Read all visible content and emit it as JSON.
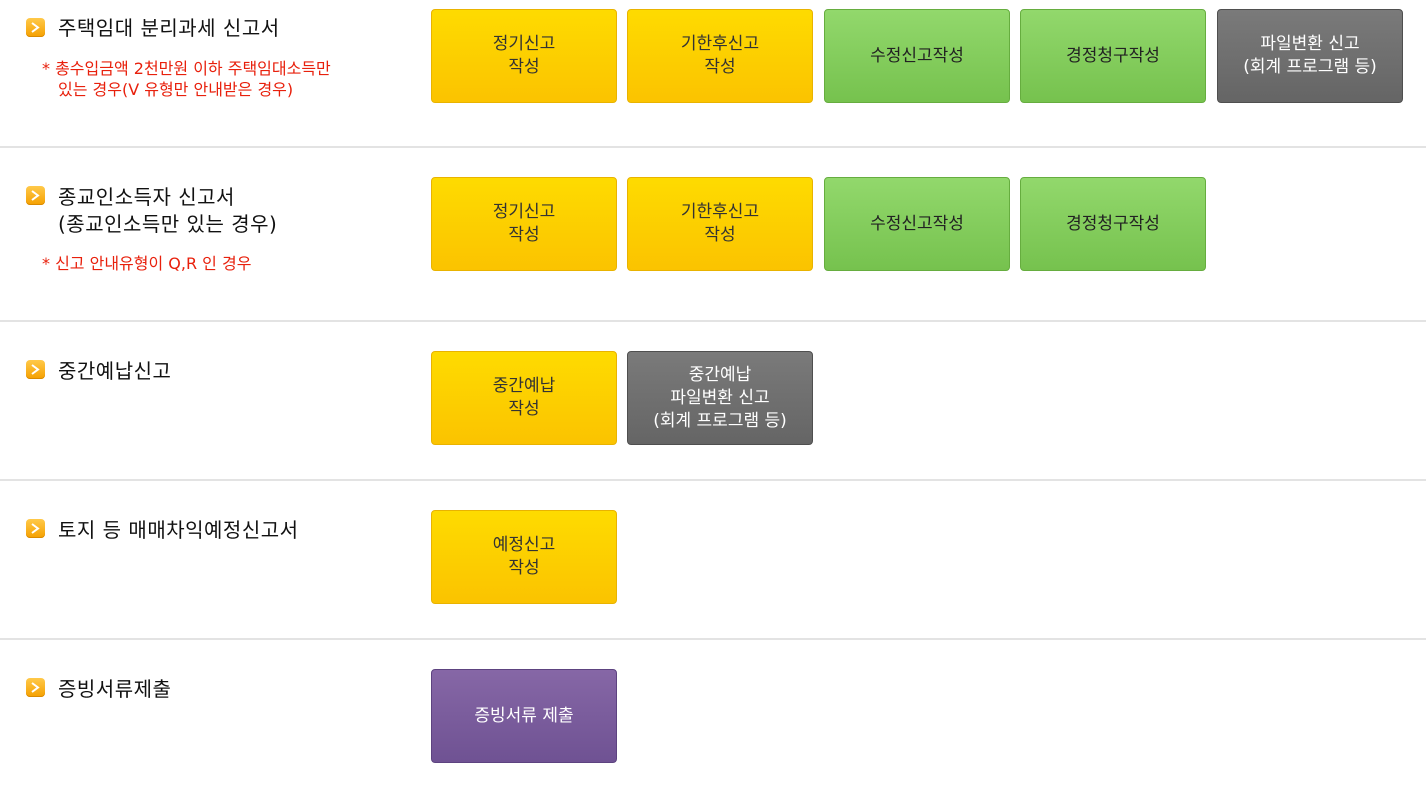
{
  "sections": [
    {
      "title_lines": [
        "주택임대 분리과세 신고서"
      ],
      "note_lines": [
        "* 총수입금액 2천만원 이하 주택임대소득만",
        "있는 경우(V 유형만 안내받은 경우)"
      ],
      "buttons": [
        {
          "label": "정기신고\n작성",
          "style": "yellow"
        },
        {
          "label": "기한후신고\n작성",
          "style": "yellow"
        },
        {
          "label": "수정신고작성",
          "style": "green"
        },
        {
          "label": "경정청구작성",
          "style": "green"
        },
        {
          "label": "파일변환 신고\n(회계 프로그램 등)",
          "style": "gray"
        }
      ]
    },
    {
      "title_lines": [
        "종교인소득자 신고서",
        "(종교인소득만 있는 경우)"
      ],
      "note_lines": [
        "* 신고 안내유형이 Q,R 인 경우"
      ],
      "buttons": [
        {
          "label": "정기신고\n작성",
          "style": "yellow"
        },
        {
          "label": "기한후신고\n작성",
          "style": "yellow"
        },
        {
          "label": "수정신고작성",
          "style": "green"
        },
        {
          "label": "경정청구작성",
          "style": "green"
        }
      ]
    },
    {
      "title_lines": [
        "중간예납신고"
      ],
      "note_lines": [],
      "buttons": [
        {
          "label": "중간예납\n작성",
          "style": "yellow"
        },
        {
          "label": "중간예납\n파일변환 신고\n(회계 프로그램 등)",
          "style": "gray"
        }
      ]
    },
    {
      "title_lines": [
        "토지 등 매매차익예정신고서"
      ],
      "note_lines": [],
      "buttons": [
        {
          "label": "예정신고\n작성",
          "style": "yellow"
        }
      ]
    },
    {
      "title_lines": [
        "증빙서류제출"
      ],
      "note_lines": [],
      "buttons": [
        {
          "label": "증빙서류 제출",
          "style": "purple"
        }
      ]
    }
  ],
  "colors": {
    "yellow": "#fcd000",
    "green": "#84cd5d",
    "gray": "#6e6e6e",
    "purple": "#7a5c9d",
    "note_red": "#e8200c",
    "divider": "#e3e3e3"
  }
}
